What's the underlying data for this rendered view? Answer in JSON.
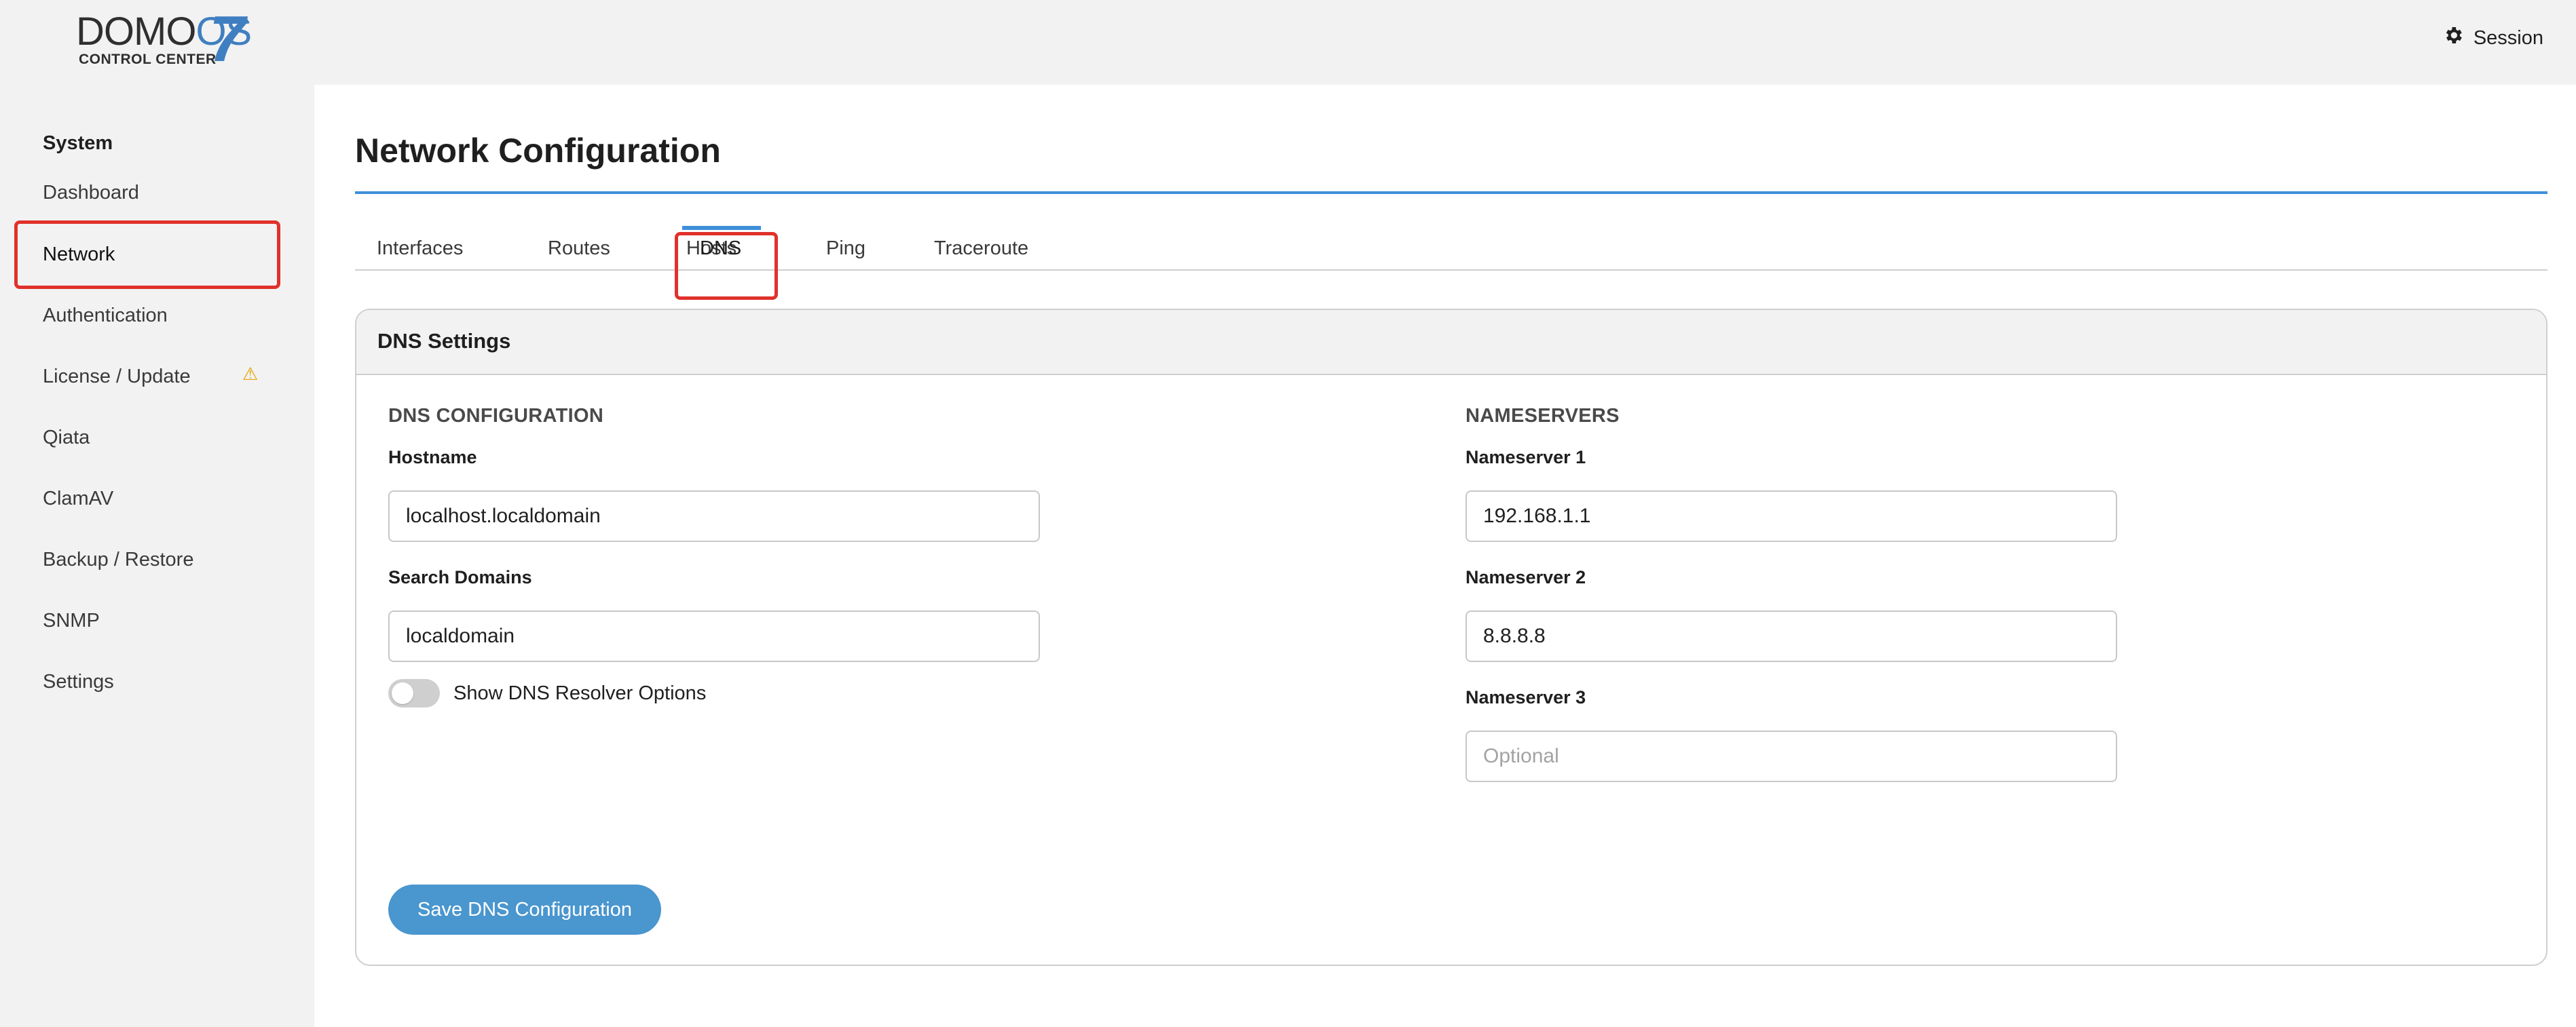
{
  "logo": {
    "word_main": "DOMO",
    "word_os": "OS",
    "version": "7",
    "subtitle": "CONTROL CENTER"
  },
  "header": {
    "session_label": "Session"
  },
  "sidebar": {
    "heading": "System",
    "items": [
      {
        "label": "Dashboard"
      },
      {
        "label": "Network",
        "active": true
      },
      {
        "label": "Authentication"
      },
      {
        "label": "License / Update",
        "warning": true
      },
      {
        "label": "Qiata"
      },
      {
        "label": "ClamAV"
      },
      {
        "label": "Backup / Restore"
      },
      {
        "label": "SNMP"
      },
      {
        "label": "Settings"
      }
    ]
  },
  "main": {
    "title": "Network Configuration",
    "tabs": [
      {
        "label": "Interfaces"
      },
      {
        "label": "Routes"
      },
      {
        "label": "Hosts"
      },
      {
        "label": "DNS",
        "active": true
      },
      {
        "label": "Ping"
      },
      {
        "label": "Traceroute"
      }
    ],
    "card": {
      "title": "DNS Settings",
      "dns_config": {
        "section_label": "DNS CONFIGURATION",
        "hostname_label": "Hostname",
        "hostname_value": "localhost.localdomain",
        "search_domains_label": "Search Domains",
        "search_domains_value": "localdomain",
        "resolver_toggle_label": "Show DNS Resolver Options",
        "resolver_toggle_on": false
      },
      "nameservers": {
        "section_label": "NAMESERVERS",
        "ns1_label": "Nameserver 1",
        "ns1_value": "192.168.1.1",
        "ns2_label": "Nameserver 2",
        "ns2_value": "8.8.8.8",
        "ns3_label": "Nameserver 3",
        "ns3_value": "",
        "ns3_placeholder": "Optional"
      },
      "save_label": "Save DNS Configuration"
    }
  },
  "colors": {
    "accent": "#3f8fd8",
    "button": "#4a96cf",
    "highlight": "#e0312b",
    "warning": "#e6a400"
  },
  "icons": {
    "session": "gear-icon",
    "license_warning": "warning-triangle-icon"
  }
}
